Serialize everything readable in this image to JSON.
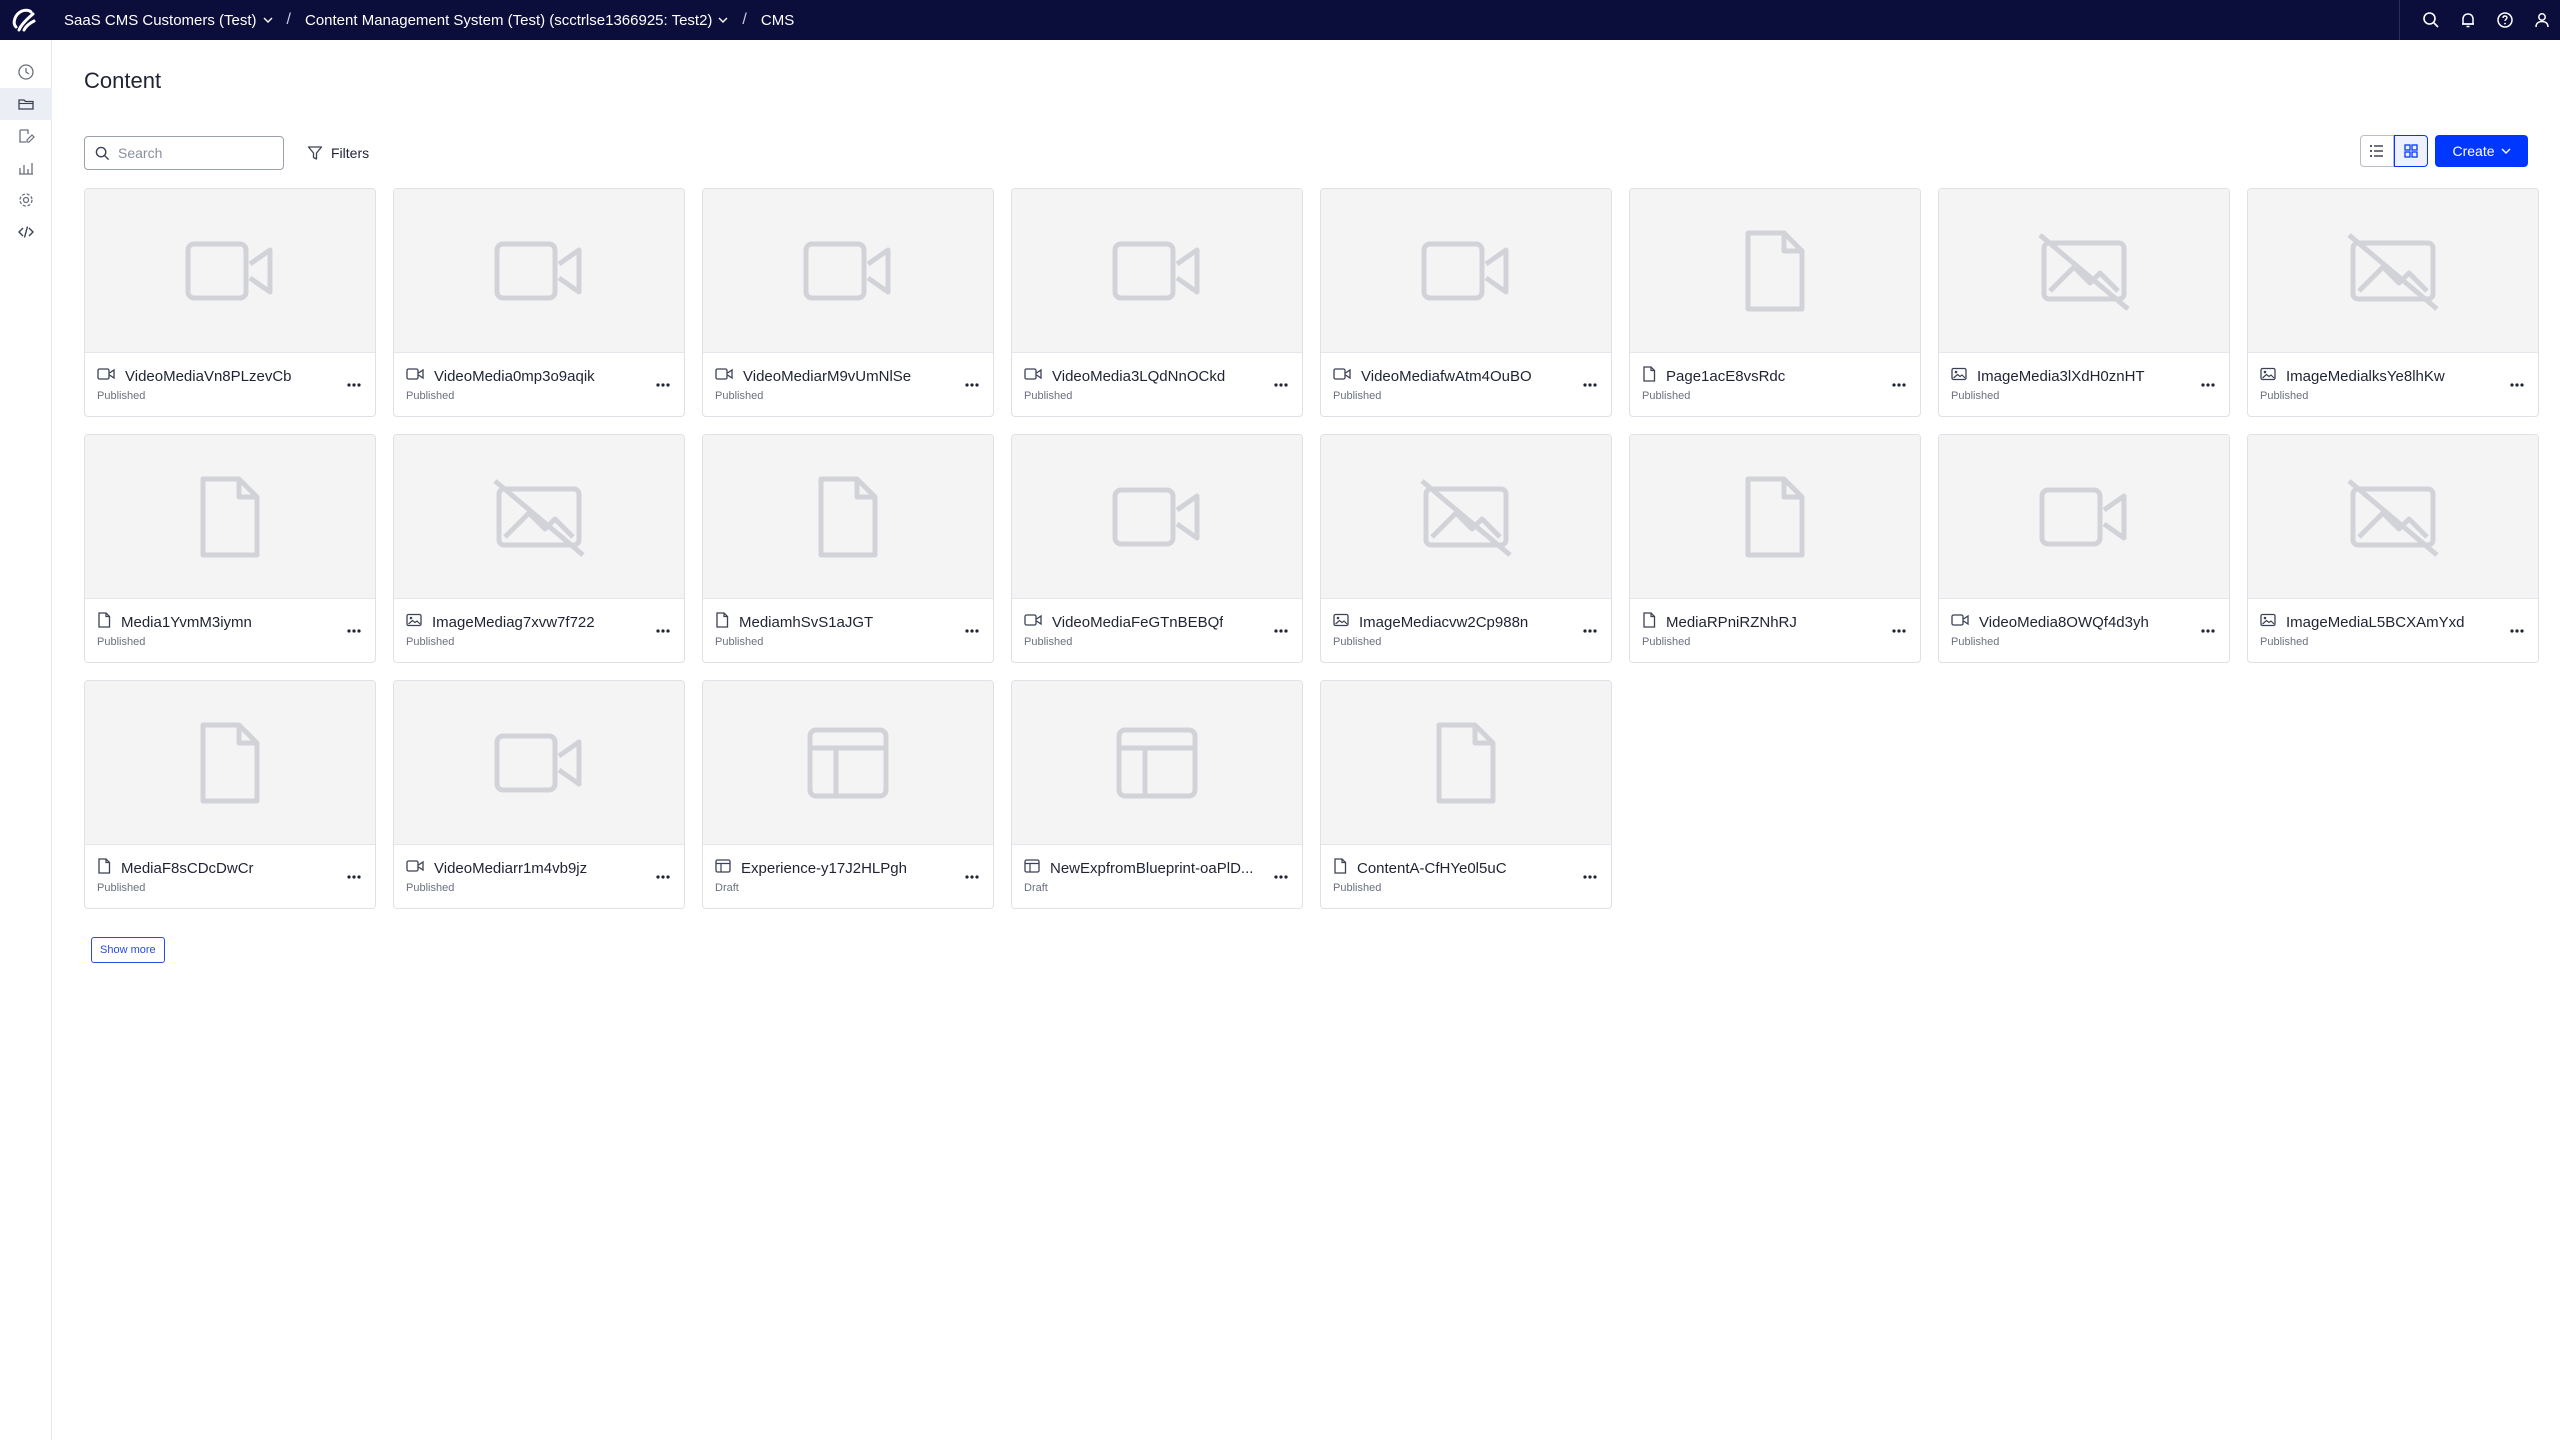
{
  "topbar": {
    "org": "SaaS CMS Customers (Test)",
    "instance": "Content Management System (Test) (scctrlse1366925: Test2)",
    "app": "CMS",
    "separator": "/"
  },
  "main": {
    "title": "Content",
    "search_placeholder": "Search",
    "filters_label": "Filters",
    "create_label": "Create",
    "show_more_label": "Show more"
  },
  "items": [
    {
      "name": "VideoMediaVn8PLzevCb",
      "status": "Published",
      "type": "video"
    },
    {
      "name": "VideoMedia0mp3o9aqik",
      "status": "Published",
      "type": "video"
    },
    {
      "name": "VideoMediarM9vUmNlSe",
      "status": "Published",
      "type": "video"
    },
    {
      "name": "VideoMedia3LQdNnOCkd",
      "status": "Published",
      "type": "video"
    },
    {
      "name": "VideoMediafwAtm4OuBO",
      "status": "Published",
      "type": "video"
    },
    {
      "name": "Page1acE8vsRdc",
      "status": "Published",
      "type": "page"
    },
    {
      "name": "ImageMedia3lXdH0znHT",
      "status": "Published",
      "type": "image"
    },
    {
      "name": "ImageMedialksYe8lhKw",
      "status": "Published",
      "type": "image"
    },
    {
      "name": "Media1YvmM3iymn",
      "status": "Published",
      "type": "page"
    },
    {
      "name": "ImageMediag7xvw7f722",
      "status": "Published",
      "type": "image"
    },
    {
      "name": "MediamhSvS1aJGT",
      "status": "Published",
      "type": "page"
    },
    {
      "name": "VideoMediaFeGTnBEBQf",
      "status": "Published",
      "type": "video"
    },
    {
      "name": "ImageMediacvw2Cp988n",
      "status": "Published",
      "type": "image"
    },
    {
      "name": "MediaRPniRZNhRJ",
      "status": "Published",
      "type": "page"
    },
    {
      "name": "VideoMedia8OWQf4d3yh",
      "status": "Published",
      "type": "video"
    },
    {
      "name": "ImageMediaL5BCXAmYxd",
      "status": "Published",
      "type": "image"
    },
    {
      "name": "MediaF8sCDcDwCr",
      "status": "Published",
      "type": "page"
    },
    {
      "name": "VideoMediarr1m4vb9jz",
      "status": "Published",
      "type": "video"
    },
    {
      "name": "Experience-y17J2HLPgh",
      "status": "Draft",
      "type": "experience"
    },
    {
      "name": "NewExpfromBlueprint-oaPlD...",
      "status": "Draft",
      "type": "experience"
    },
    {
      "name": "ContentA-CfHYe0l5uC",
      "status": "Published",
      "type": "page"
    }
  ],
  "icons": {
    "rail": [
      "dashboard-icon",
      "content-folder-icon",
      "edit-icon",
      "analytics-icon",
      "settings-icon",
      "code-icon"
    ],
    "top_actions": [
      "search-icon",
      "bell-icon",
      "help-icon",
      "user-icon"
    ]
  },
  "colors": {
    "topbar_bg": "#0b0d3b",
    "accent": "#0037ff",
    "thumb_bg": "#f4f4f5"
  }
}
